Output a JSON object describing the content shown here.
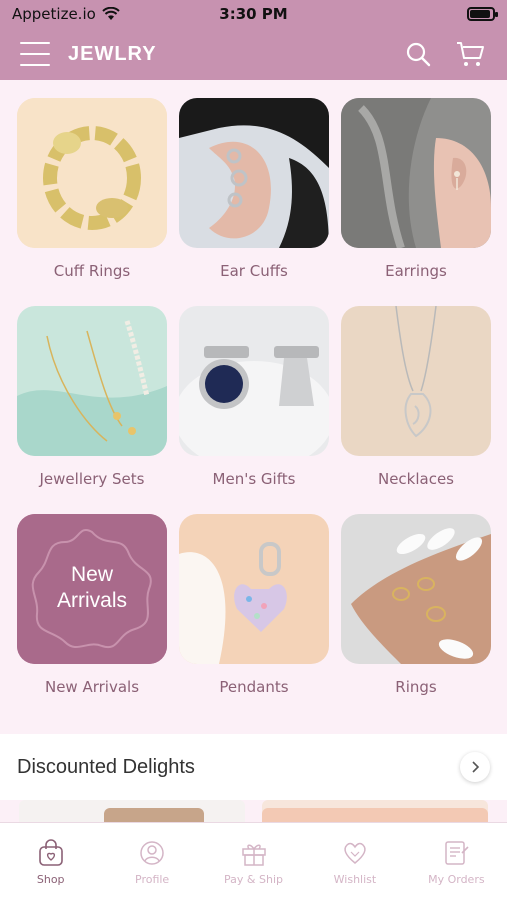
{
  "status": {
    "carrier": "Appetize.io",
    "time": "3:30 PM",
    "battery_level": 0.9
  },
  "header": {
    "title": "JEWLRY",
    "menu_icon": "hamburger-icon",
    "search_icon": "search-icon",
    "cart_icon": "cart-icon"
  },
  "categories": [
    {
      "label": "Cuff Rings"
    },
    {
      "label": "Ear Cuffs"
    },
    {
      "label": "Earrings"
    },
    {
      "label": "Jewellery Sets"
    },
    {
      "label": "Men's Gifts"
    },
    {
      "label": "Necklaces"
    },
    {
      "label": "New Arrivals",
      "badge_line1": "New",
      "badge_line2": "Arrivals"
    },
    {
      "label": "Pendants"
    },
    {
      "label": "Rings"
    }
  ],
  "section": {
    "title": "Discounted Delights",
    "arrow_icon": "chevron-right-icon"
  },
  "tabs": [
    {
      "label": "Shop",
      "icon": "shopping-bag-icon",
      "active": true
    },
    {
      "label": "Profile",
      "icon": "profile-icon",
      "active": false
    },
    {
      "label": "Pay & Ship",
      "icon": "gift-icon",
      "active": false
    },
    {
      "label": "Wishlist",
      "icon": "heart-icon",
      "active": false
    },
    {
      "label": "My Orders",
      "icon": "orders-icon",
      "active": false
    }
  ],
  "colors": {
    "brand": "#c792b0",
    "accent_text": "#8b6176",
    "background": "#fcf0f7"
  }
}
